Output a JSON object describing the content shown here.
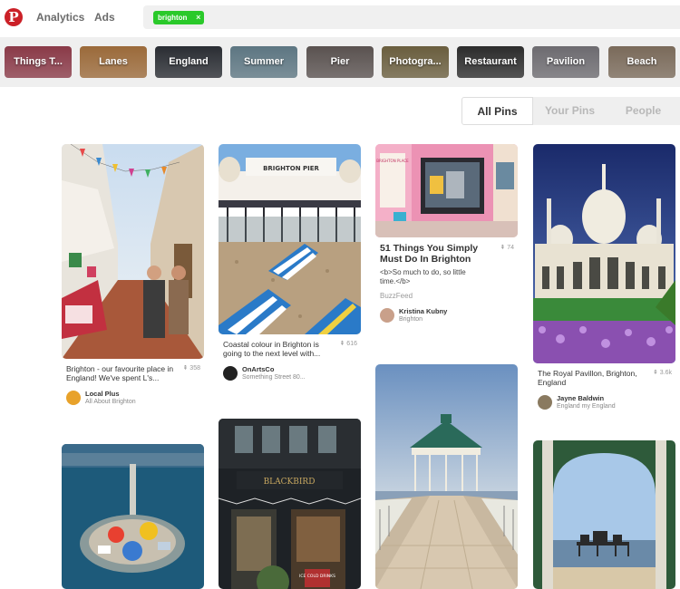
{
  "header": {
    "logo": "P",
    "nav": [
      "Analytics",
      "Ads"
    ],
    "search_tag": "brighton",
    "search_tag_remove": "×"
  },
  "guides": [
    {
      "label": "Things T...",
      "color": "#8a3a48"
    },
    {
      "label": "Lanes",
      "color": "#9b6a3a"
    },
    {
      "label": "England",
      "color": "#2a2d33"
    },
    {
      "label": "Summer",
      "color": "#5d7682"
    },
    {
      "label": "Pier",
      "color": "#5a5250"
    },
    {
      "label": "Photogra...",
      "color": "#6a5e3e"
    },
    {
      "label": "Restaurant",
      "color": "#2c2c2c"
    },
    {
      "label": "Pavilion",
      "color": "#6d6b70"
    },
    {
      "label": "Beach",
      "color": "#7a6a5a"
    }
  ],
  "tabs": [
    "All Pins",
    "Your Pins",
    "People"
  ],
  "pins": [
    {
      "desc": "Brighton - our favourite place in England! We've spent L's...",
      "repins": "⇞ 358",
      "pinner": "Local Plus",
      "board": "All About Brighton",
      "avatar_color": "#e8a22a"
    },
    {
      "desc": "Coastal colour in Brighton is going to the next level with...",
      "repins": "⇞ 616",
      "pinner": "OnArtsCo",
      "board": "Something Street 80...",
      "avatar_color": "#222222"
    },
    {
      "title": "51 Things You Simply Must Do In Brighton",
      "sub": "<b>So much to do, so little time.</b>",
      "source": "BuzzFeed",
      "repins": "⇞ 74",
      "pinner": "Kristina Kubny",
      "board": "Brighton",
      "avatar_color": "#c9a08a"
    },
    {
      "desc": "The Royal Pavillon, Brighton, England",
      "repins": "⇞ 3.6k",
      "pinner": "Jayne Baldwin",
      "board": "England my England",
      "avatar_color": "#8a7a60"
    }
  ],
  "photo_text": {
    "pier_sign": "BRIGHTON PIER",
    "place_sign": "BRIGHTON PLACE",
    "cafe_sign": "BLACKBIRD",
    "drinks_sign": "ICE COLD DRINKS"
  }
}
